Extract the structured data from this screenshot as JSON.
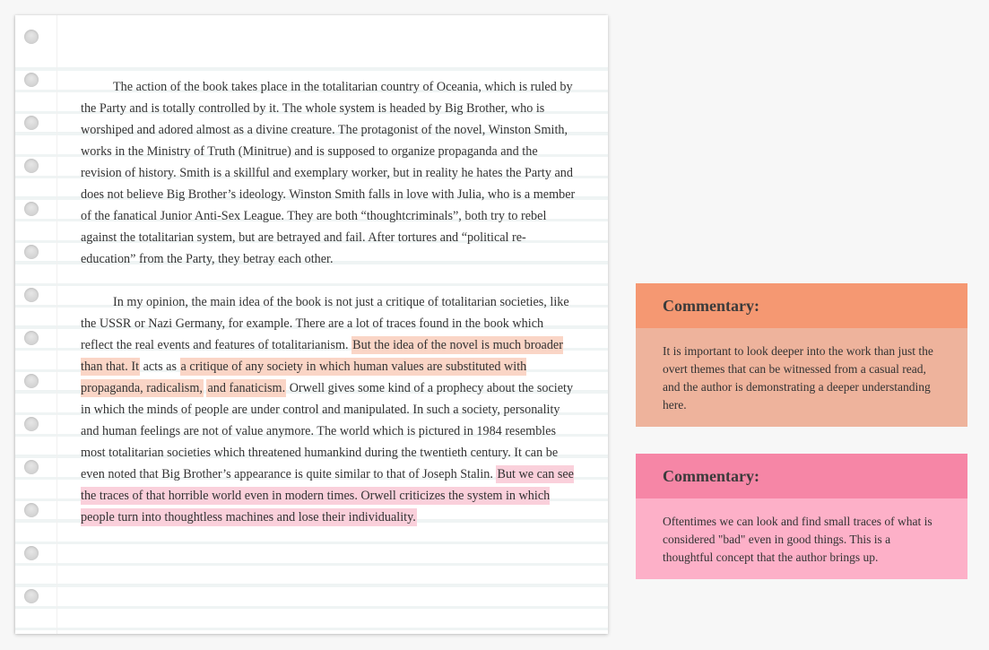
{
  "document": {
    "paragraphs": [
      {
        "segments": [
          {
            "text": "The action of the book takes place in the totalitarian country of Oceania, which is ruled by the Party and is totally controlled by it. The whole system is headed by Big Brother, who is worshiped and adored almost as a divine creature. The protagonist of the novel, Winston Smith, works in the Ministry of Truth (Minitrue) and is supposed to organize propaganda and the revision of history. Smith is a skillful and exemplary worker, but in reality he hates the Party and does not believe Big Brother’s ideology. Winston Smith falls in love with Julia, who is a member of the fanatical Junior Anti-Sex League. They are both “thoughtcriminals”, both try to rebel against the totalitarian system, but are betrayed and fail. After tortures and “political re-education” from the Party, they betray each other.",
            "highlight": null
          }
        ]
      },
      {
        "segments": [
          {
            "text": "In my opinion, the main idea of the book is not just a critique of totalitarian societies, like the USSR or Nazi Germany, for example. There are a lot of traces found in the book which reflect the real events and features of totalitarianism. ",
            "highlight": null
          },
          {
            "text": "But the idea of the novel is much broader than that. It",
            "highlight": "orange"
          },
          {
            "text": " acts as ",
            "highlight": null
          },
          {
            "text": "a critique of any society in which human values are substituted with propaganda, radicalism,",
            "highlight": "orange"
          },
          {
            "text": " ",
            "highlight": null
          },
          {
            "text": "and fanaticism.",
            "highlight": "orange"
          },
          {
            "text": " Orwell gives some kind of a prophecy about the society in which the minds of people are under control and manipulated. In such a society, personality and human feelings are not of value anymore. The world which is pictured in 1984 resembles most totalitarian societies which threatened humankind during the twentieth century. It can be even noted that Big Brother’s appearance is quite similar to that of Joseph Stalin. ",
            "highlight": null
          },
          {
            "text": "But we can see the traces of that horrible world even in modern times. Orwell criticizes the system in which people turn into thoughtless machines and lose their individuality.",
            "highlight": "pink"
          }
        ]
      }
    ]
  },
  "comments": [
    {
      "title": "Commentary:",
      "body": "It is important to look deeper into the work than just the overt themes that can be witnessed from a casual read, and the author is demonstrating a deeper understanding here.",
      "color": "orange"
    },
    {
      "title": "Commentary:",
      "body": "Oftentimes we can look and find small traces of what is considered \"bad\" even in good things. This is a thoughtful concept that the author brings up.",
      "color": "pink"
    }
  ],
  "colors": {
    "highlight_orange": "#fad5c6",
    "highlight_pink": "#fad0db",
    "comment_orange_header": "#f59872",
    "comment_orange_body": "#eeb39c",
    "comment_pink_header": "#f686a6",
    "comment_pink_body": "#fdb0c8"
  }
}
